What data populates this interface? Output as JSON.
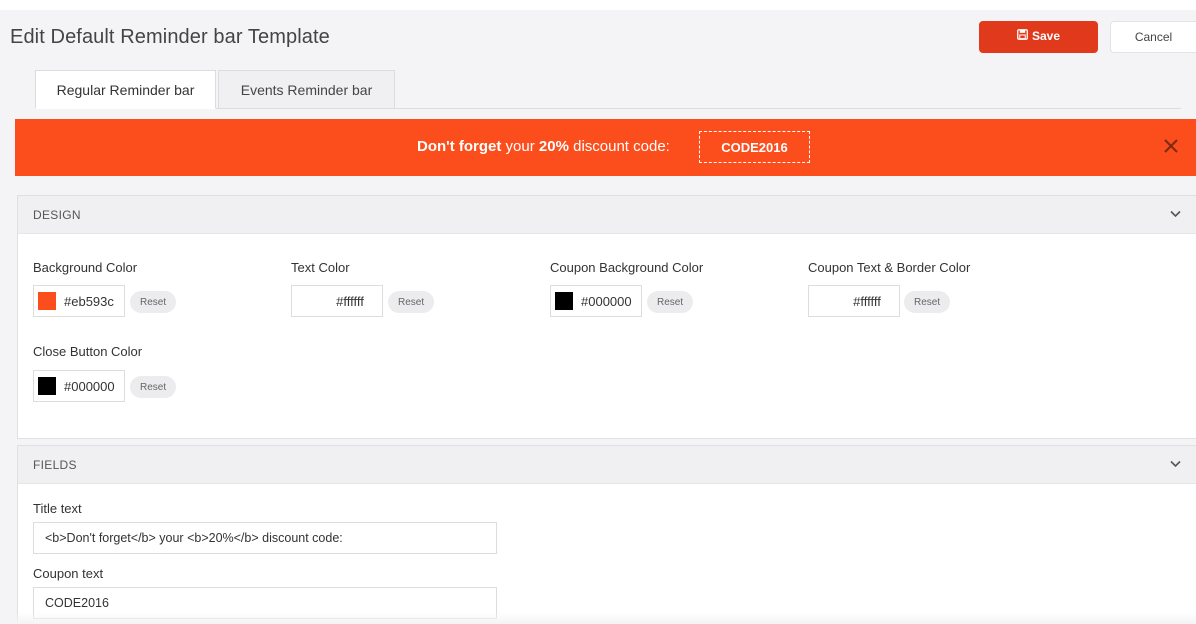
{
  "header": {
    "title": "Edit Default Reminder bar Template",
    "save_label": "Save",
    "cancel_label": "Cancel"
  },
  "tabs": [
    {
      "label": "Regular Reminder bar",
      "active": true
    },
    {
      "label": "Events Reminder bar",
      "active": false
    }
  ],
  "preview": {
    "text_bold_1": "Don't forget",
    "text_1": " your ",
    "text_bold_2": "20%",
    "text_2": " discount code:",
    "coupon": "CODE2016",
    "background": "#fc4d1d"
  },
  "design": {
    "header": "DESIGN",
    "reset_label": "Reset",
    "background_color": {
      "label": "Background Color",
      "value": "#eb593c",
      "swatch": "#eb593c"
    },
    "text_color": {
      "label": "Text Color",
      "value": "#ffffff",
      "swatch": "#ffffff"
    },
    "coupon_background_color": {
      "label": "Coupon Background Color",
      "value": "#000000",
      "swatch": "#000000"
    },
    "coupon_text_border_color": {
      "label": "Coupon Text & Border Color",
      "value": "#ffffff",
      "swatch": "#ffffff"
    },
    "close_button_color": {
      "label": "Close Button Color",
      "value": "#000000",
      "swatch": "#000000"
    }
  },
  "fields": {
    "header": "FIELDS",
    "title_text": {
      "label": "Title text",
      "value": "<b>Don't forget</b> your <b>20%</b> discount code:"
    },
    "coupon_text": {
      "label": "Coupon text",
      "value": "CODE2016"
    }
  }
}
